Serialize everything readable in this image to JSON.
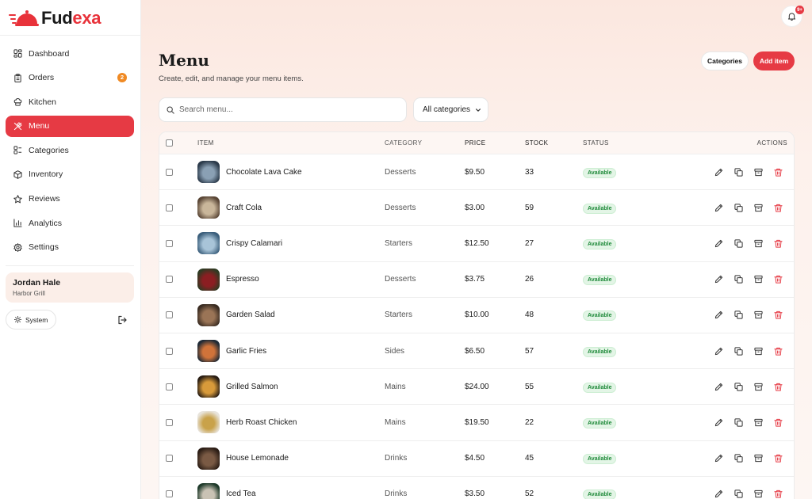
{
  "app": {
    "brand_part1": "Fud",
    "brand_part2": "exa"
  },
  "sidebar": {
    "items": [
      {
        "label": "Dashboard",
        "icon": "dashboard-icon"
      },
      {
        "label": "Orders",
        "icon": "clipboard-icon",
        "badge": "2"
      },
      {
        "label": "Kitchen",
        "icon": "chef-hat-icon"
      },
      {
        "label": "Menu",
        "icon": "utensils-icon",
        "active": true
      },
      {
        "label": "Categories",
        "icon": "categories-icon"
      },
      {
        "label": "Inventory",
        "icon": "box-icon"
      },
      {
        "label": "Reviews",
        "icon": "star-icon"
      },
      {
        "label": "Analytics",
        "icon": "bar-chart-icon"
      },
      {
        "label": "Settings",
        "icon": "gear-icon"
      }
    ],
    "user": {
      "name": "Jordan Hale",
      "place": "Harbor Grill"
    },
    "theme_label": "System"
  },
  "header": {
    "notification_count": "9+"
  },
  "page": {
    "title": "Menu",
    "subtitle": "Create, edit, and manage your menu items.",
    "categories_button": "Categories",
    "add_button": "Add item"
  },
  "filters": {
    "search_placeholder": "Search menu...",
    "category_selected": "All categories"
  },
  "table": {
    "headers": {
      "item": "ITEM",
      "category": "CATEGORY",
      "price": "PRICE",
      "stock": "STOCK",
      "status": "STATUS",
      "actions": "ACTIONS"
    },
    "rows": [
      {
        "name": "Chocolate Lava Cake",
        "category": "Desserts",
        "price": "$9.50",
        "stock": "33",
        "status": "Available",
        "thumb_colors": [
          "#2b3a4a",
          "#8aa0b4"
        ]
      },
      {
        "name": "Craft Cola",
        "category": "Desserts",
        "price": "$3.00",
        "stock": "59",
        "status": "Available",
        "thumb_colors": [
          "#5a4636",
          "#c9b69a"
        ]
      },
      {
        "name": "Crispy Calamari",
        "category": "Starters",
        "price": "$12.50",
        "stock": "27",
        "status": "Available",
        "thumb_colors": [
          "#3b5f7c",
          "#a8c4d8"
        ]
      },
      {
        "name": "Espresso",
        "category": "Desserts",
        "price": "$3.75",
        "stock": "26",
        "status": "Available",
        "thumb_colors": [
          "#2f3b23",
          "#8b1e22"
        ]
      },
      {
        "name": "Garden Salad",
        "category": "Starters",
        "price": "$10.00",
        "stock": "48",
        "status": "Available",
        "thumb_colors": [
          "#3a2c22",
          "#9a7456"
        ]
      },
      {
        "name": "Garlic Fries",
        "category": "Sides",
        "price": "$6.50",
        "stock": "57",
        "status": "Available",
        "thumb_colors": [
          "#1f2a36",
          "#d0733a"
        ]
      },
      {
        "name": "Grilled Salmon",
        "category": "Mains",
        "price": "$24.00",
        "stock": "55",
        "status": "Available",
        "thumb_colors": [
          "#2a1e14",
          "#d89a3a"
        ]
      },
      {
        "name": "Herb Roast Chicken",
        "category": "Mains",
        "price": "$19.50",
        "stock": "22",
        "status": "Available",
        "thumb_colors": [
          "#e8e4dc",
          "#c9a24a"
        ]
      },
      {
        "name": "House Lemonade",
        "category": "Drinks",
        "price": "$4.50",
        "stock": "45",
        "status": "Available",
        "thumb_colors": [
          "#2c1e16",
          "#7a5a44"
        ]
      },
      {
        "name": "Iced Tea",
        "category": "Drinks",
        "price": "$3.50",
        "stock": "52",
        "status": "Available",
        "thumb_colors": [
          "#1e3a2a",
          "#c9c2b4"
        ]
      }
    ]
  },
  "colors": {
    "accent": "#e63a44",
    "badge_orange": "#f08a24",
    "available_green": "#1f8a3a"
  }
}
